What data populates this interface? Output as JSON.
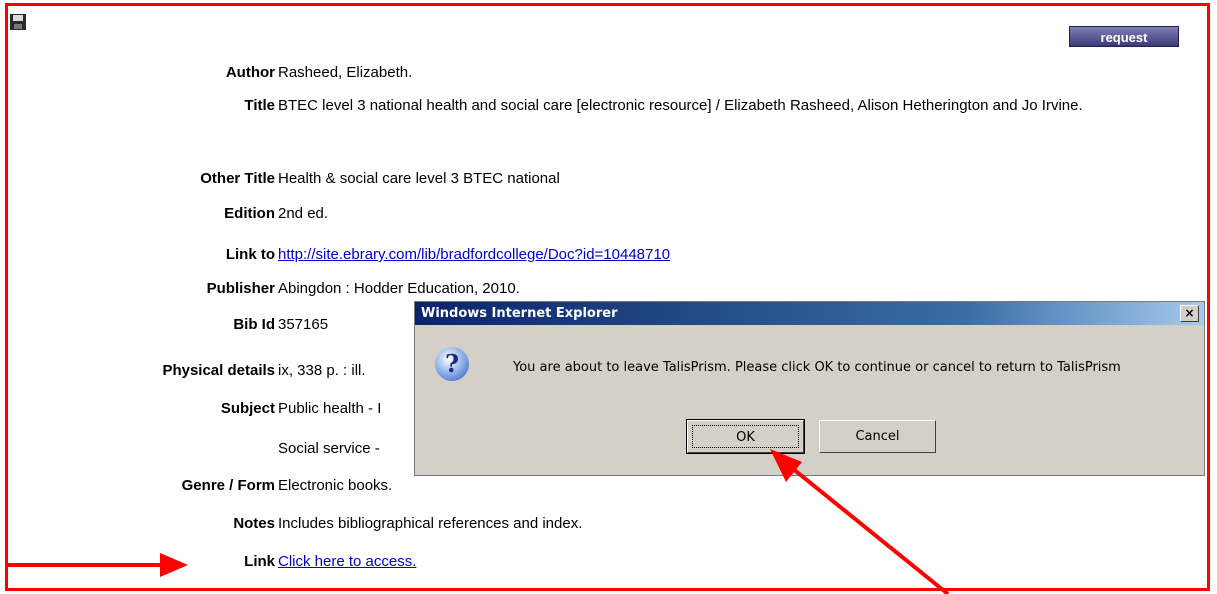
{
  "toolbar": {
    "request_label": "request"
  },
  "record": [
    {
      "label": "Author",
      "value": "Rasheed, Elizabeth."
    },
    {
      "label": "Title",
      "value": "BTEC level 3 national health and social care [electronic resource] / Elizabeth Rasheed, Alison Hetherington and Jo Irvine."
    },
    {
      "label": "Other Title",
      "value": "Health & social care level 3 BTEC national"
    },
    {
      "label": "Edition",
      "value": "2nd ed."
    },
    {
      "label": "Link to",
      "value": "http://site.ebrary.com/lib/bradfordcollege/Doc?id=10448710"
    },
    {
      "label": "Publisher",
      "value": "Abingdon : Hodder Education, 2010."
    },
    {
      "label": "Bib Id",
      "value": "357165"
    },
    {
      "label": "Physical details",
      "value": "ix, 338 p. : ill."
    },
    {
      "label": "Subject",
      "value": "Public health - I"
    },
    {
      "label": "",
      "value": "Social service -"
    },
    {
      "label": "Genre / Form",
      "value": "Electronic books."
    },
    {
      "label": "Notes",
      "value": "Includes bibliographical references and index."
    },
    {
      "label": "Link",
      "value": "Click here to access."
    }
  ],
  "dialog": {
    "title": "Windows Internet Explorer",
    "close": "×",
    "icon": "question-icon",
    "message": "You are about to leave TalisPrism. Please click OK to continue or cancel to return to TalisPrism",
    "ok_label": "OK",
    "cancel_label": "Cancel"
  },
  "colors": {
    "annotation": "#ff0000",
    "link": "#0000cc",
    "titlebar": "#0a246a"
  }
}
